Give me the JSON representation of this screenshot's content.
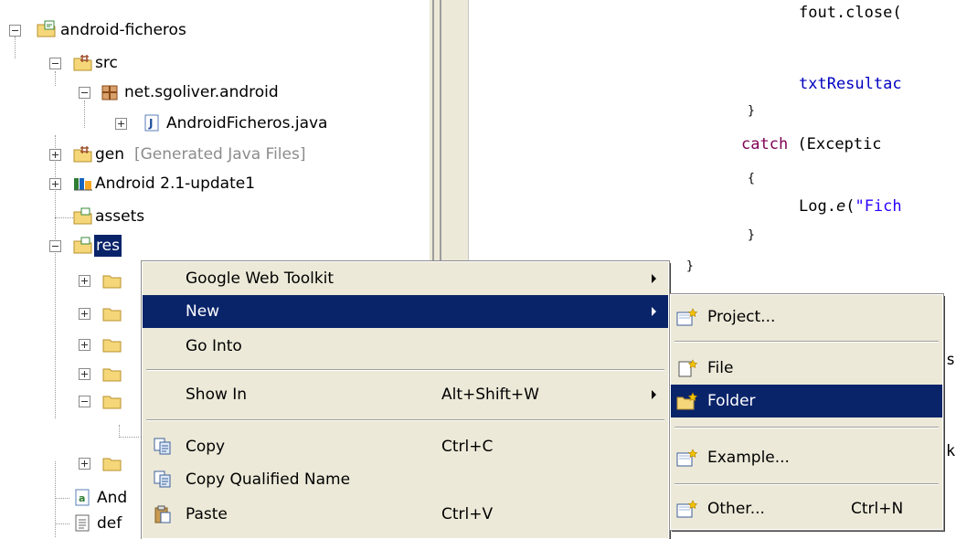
{
  "tree": {
    "project": "android-ficheros",
    "src": "src",
    "package": "net.sgoliver.android",
    "java_file": "AndroidFicheros.java",
    "gen": "gen",
    "gen_note": "[Generated Java Files]",
    "android_lib": "Android 2.1-update1",
    "assets": "assets",
    "res": "res",
    "partial_1": "And",
    "partial_2": "def"
  },
  "code": {
    "line1": "fout.close(",
    "line2": "txtResultac",
    "line3": "}",
    "line4_kw": "catch",
    "line4_rest": " (Exceptic",
    "line5": "{",
    "line6_a": "Log.",
    "line6_b": "e",
    "line6_c": "(",
    "line6_str": "\"Fich",
    "line7": "}",
    "line8": "}",
    "frag_s": "s",
    "frag_k": "k"
  },
  "context_menu": {
    "items": [
      {
        "label": "Google Web Toolkit"
      },
      {
        "label": "New"
      },
      {
        "label": "Go Into"
      },
      {
        "label": "Show In",
        "shortcut": "Alt+Shift+W"
      },
      {
        "label": "Copy",
        "shortcut": "Ctrl+C"
      },
      {
        "label": "Copy Qualified Name"
      },
      {
        "label": "Paste",
        "shortcut": "Ctrl+V"
      }
    ]
  },
  "submenu_new": {
    "items": [
      {
        "label": "Project..."
      },
      {
        "label": "File"
      },
      {
        "label": "Folder"
      },
      {
        "label": "Example..."
      },
      {
        "label": "Other...",
        "shortcut": "Ctrl+N"
      }
    ]
  },
  "colors": {
    "selection": "#0a246a",
    "menu_bg": "#ece9d8",
    "keyword": "#7f0055",
    "field": "#0000c0",
    "string": "#2a00ff"
  }
}
